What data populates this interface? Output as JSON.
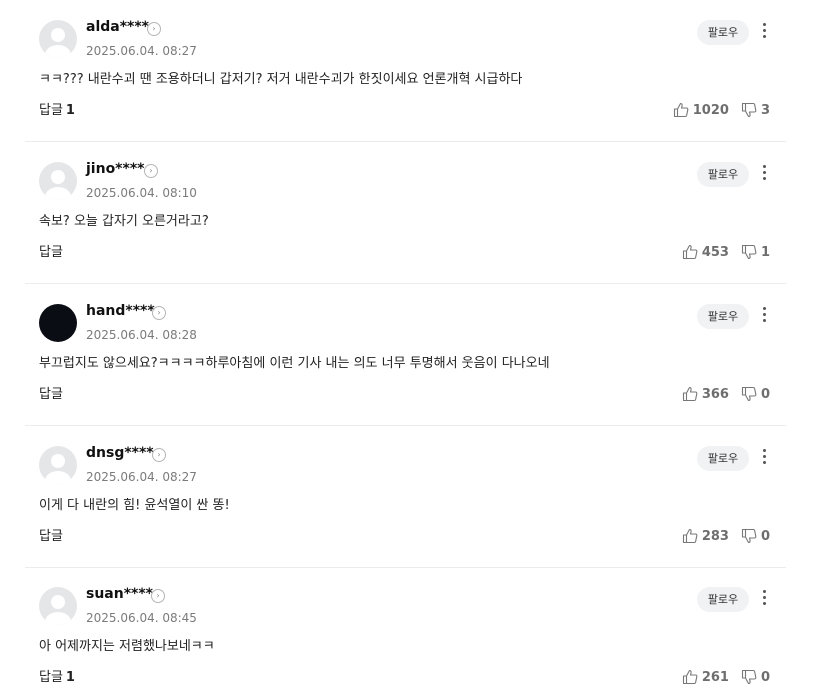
{
  "labels": {
    "follow": "팔로우",
    "reply": "답글"
  },
  "colors": {
    "avatar_default": "#e5e6e8",
    "avatar_dark": "#0b0d14",
    "follow_bg": "#f1f2f4"
  },
  "comments": [
    {
      "username": "alda****",
      "timestamp": "2025.06.04. 08:27",
      "text": "ㅋㅋ??? 내란수괴 땐 조용하더니 갑저기? 저거 내란수괴가 한짓이세요 언론개혁 시급하다",
      "reply_count": "1",
      "likes": "1020",
      "dislikes": "3",
      "avatar": "default-avatar-icon"
    },
    {
      "username": "jino****",
      "timestamp": "2025.06.04. 08:10",
      "text": "속보? 오늘 갑자기 오른거라고?",
      "reply_count": "",
      "likes": "453",
      "dislikes": "1",
      "avatar": "default-avatar-icon"
    },
    {
      "username": "hand****",
      "timestamp": "2025.06.04. 08:28",
      "text": "부끄럽지도 않으세요?ㅋㅋㅋㅋ하루아침에 이런 기사 내는 의도 너무 투명해서 웃음이 다나오네",
      "reply_count": "",
      "likes": "366",
      "dislikes": "0",
      "avatar": "dark-avatar"
    },
    {
      "username": "dnsg****",
      "timestamp": "2025.06.04. 08:27",
      "text": "이게 다 내란의 힘! 윤석열이 싼 똥!",
      "reply_count": "",
      "likes": "283",
      "dislikes": "0",
      "avatar": "default-avatar-icon"
    },
    {
      "username": "suan****",
      "timestamp": "2025.06.04. 08:45",
      "text": "아 어제까지는 저렴했나보네ㅋㅋ",
      "reply_count": "1",
      "likes": "261",
      "dislikes": "0",
      "avatar": "default-avatar-icon"
    }
  ]
}
